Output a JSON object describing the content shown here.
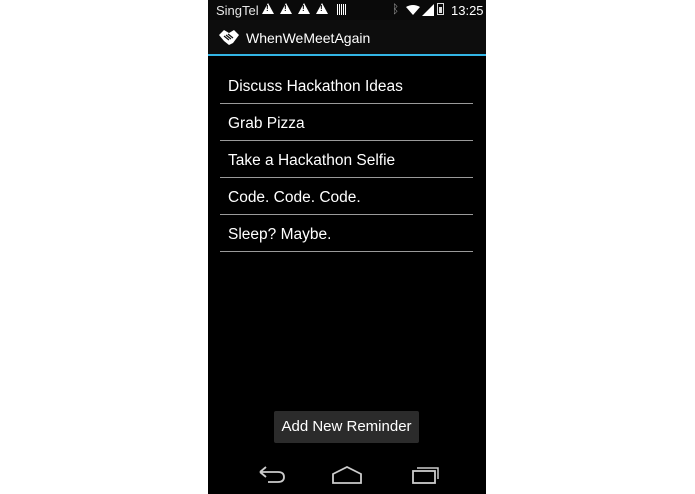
{
  "status_bar": {
    "carrier": "SingTel",
    "time": "13:25",
    "bluetooth_symbol": "ᛒ"
  },
  "action_bar": {
    "title": "WhenWeMeetAgain",
    "icon": "handshake-icon"
  },
  "reminders": [
    {
      "label": "Discuss Hackathon Ideas"
    },
    {
      "label": "Grab Pizza"
    },
    {
      "label": "Take a Hackathon Selfie"
    },
    {
      "label": "Code. Code. Code."
    },
    {
      "label": "Sleep? Maybe."
    }
  ],
  "add_button": {
    "label": "Add New Reminder"
  },
  "nav_bar": {
    "icons": [
      "back-icon",
      "home-icon",
      "recent-apps-icon"
    ]
  },
  "colors": {
    "accent": "#33b5e5",
    "background": "#000000",
    "button": "#2b2b2b"
  }
}
